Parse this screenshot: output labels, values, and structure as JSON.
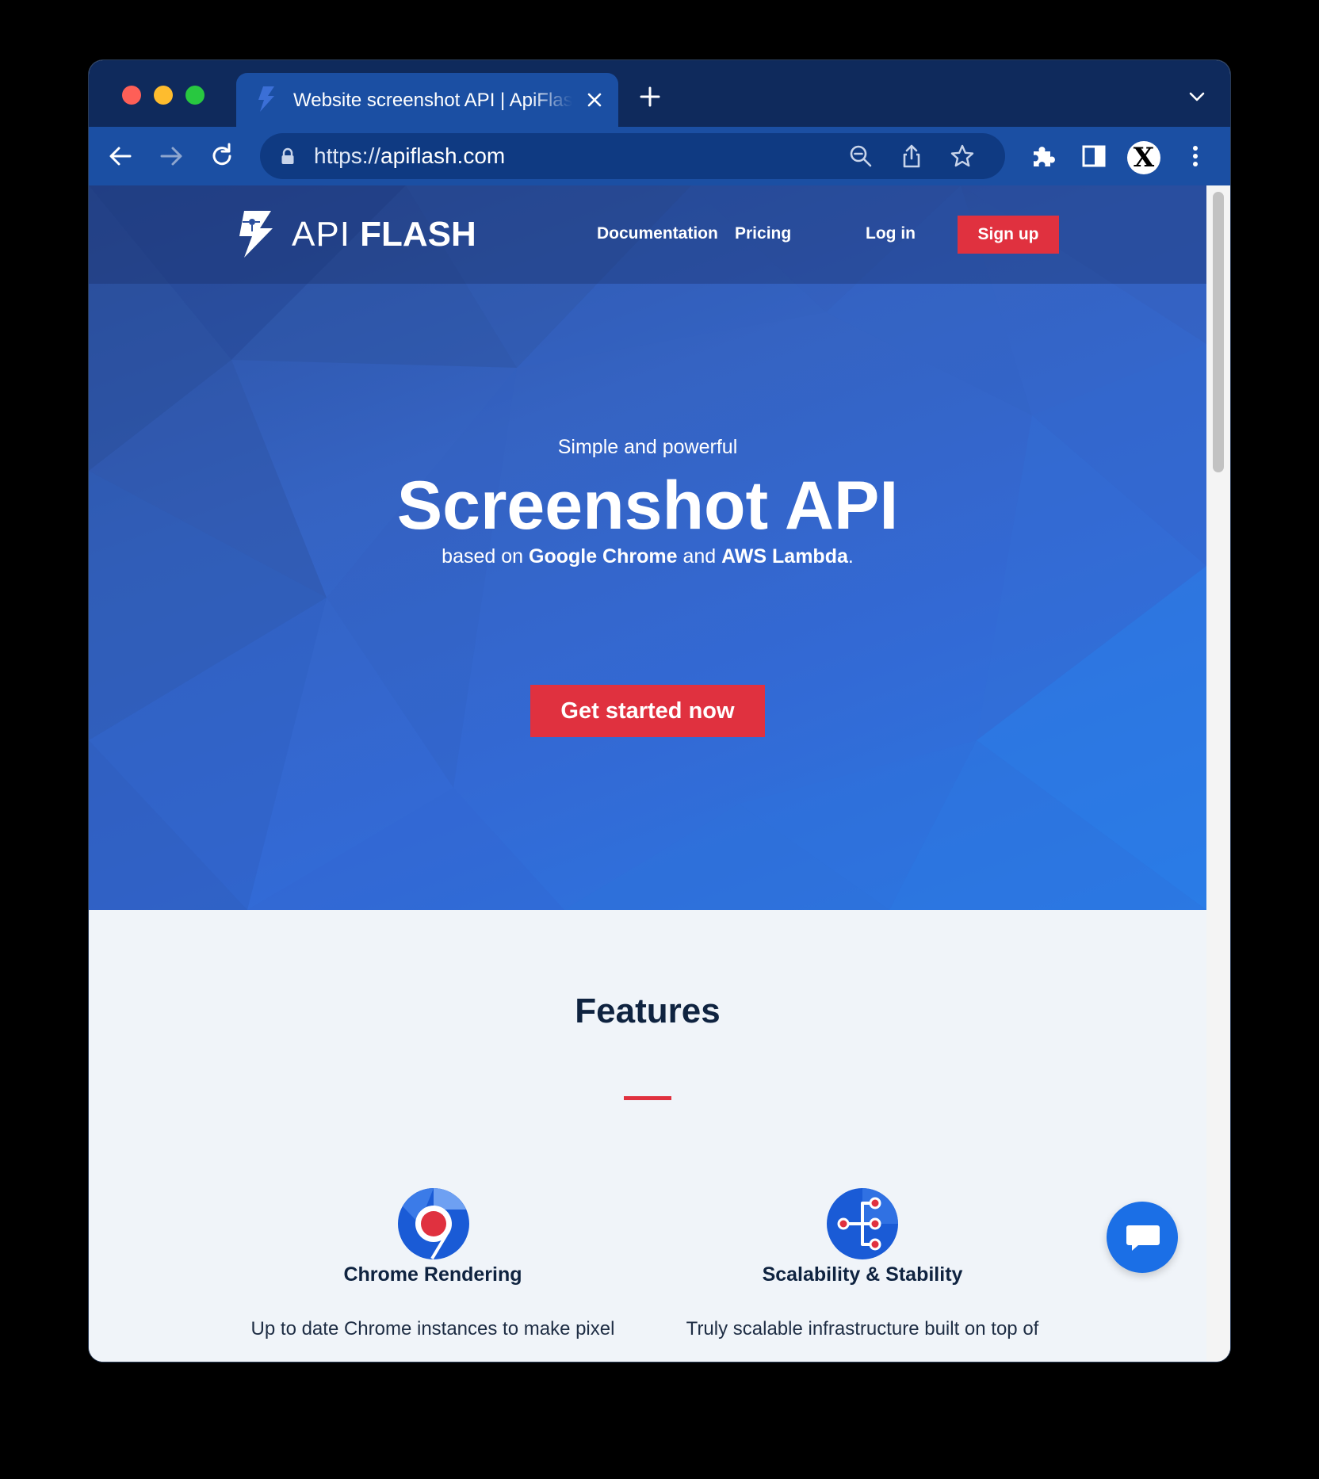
{
  "browser": {
    "tab": {
      "title": "Website screenshot API | ApiFlash"
    },
    "address_bar": {
      "scheme": "https://",
      "host": "apiflash.com"
    },
    "profile": {
      "initial": "X"
    }
  },
  "site": {
    "logo": {
      "text_thin": "API",
      "text_bold": "FLASH"
    },
    "nav": {
      "documentation": "Documentation",
      "pricing": "Pricing",
      "login": "Log in",
      "signup": "Sign up"
    },
    "hero": {
      "tagline": "Simple and powerful",
      "headline": "Screenshot API",
      "subline_prefix": "based on ",
      "subline_tech1": "Google Chrome",
      "subline_mid": " and ",
      "subline_tech2": "AWS Lambda",
      "subline_suffix": ".",
      "cta": "Get started now"
    },
    "features": {
      "title": "Features",
      "items": [
        {
          "icon": "chrome-icon",
          "title": "Chrome Rendering",
          "desc": "Up to date Chrome instances to make pixel"
        },
        {
          "icon": "scalability-icon",
          "title": "Scalability & Stability",
          "desc": "Truly scalable infrastructure built on top of"
        }
      ]
    }
  },
  "colors": {
    "accent_red": "#e0313f",
    "brand_blue": "#1b4fa3",
    "tab_strip": "#0f2a5c",
    "heading_dark": "#0f2340"
  }
}
